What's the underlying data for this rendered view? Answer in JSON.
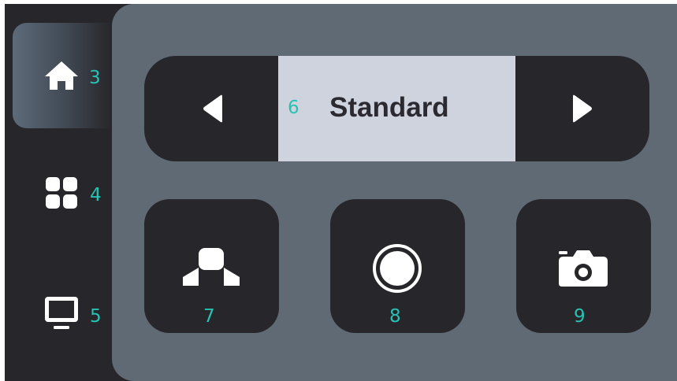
{
  "sidebar": {
    "items": [
      {
        "icon": "home-icon",
        "badge": "3",
        "active": true
      },
      {
        "icon": "grid-icon",
        "badge": "4",
        "active": false
      },
      {
        "icon": "monitor-icon",
        "badge": "5",
        "active": false
      }
    ]
  },
  "mode_selector": {
    "badge": "6",
    "mode": "Standard",
    "prev_icon": "triangle-left-icon",
    "next_icon": "triangle-right-icon"
  },
  "tiles": [
    {
      "icon": "object-shapes-icon",
      "badge": "7"
    },
    {
      "icon": "record-circle-icon",
      "badge": "8"
    },
    {
      "icon": "camera-icon",
      "badge": "9"
    }
  ],
  "colors": {
    "background": "#27262b",
    "panel": "#5f6a74",
    "selected_mode": "#cfd3de",
    "badge": "#27c3b2",
    "icon": "#ffffff"
  }
}
